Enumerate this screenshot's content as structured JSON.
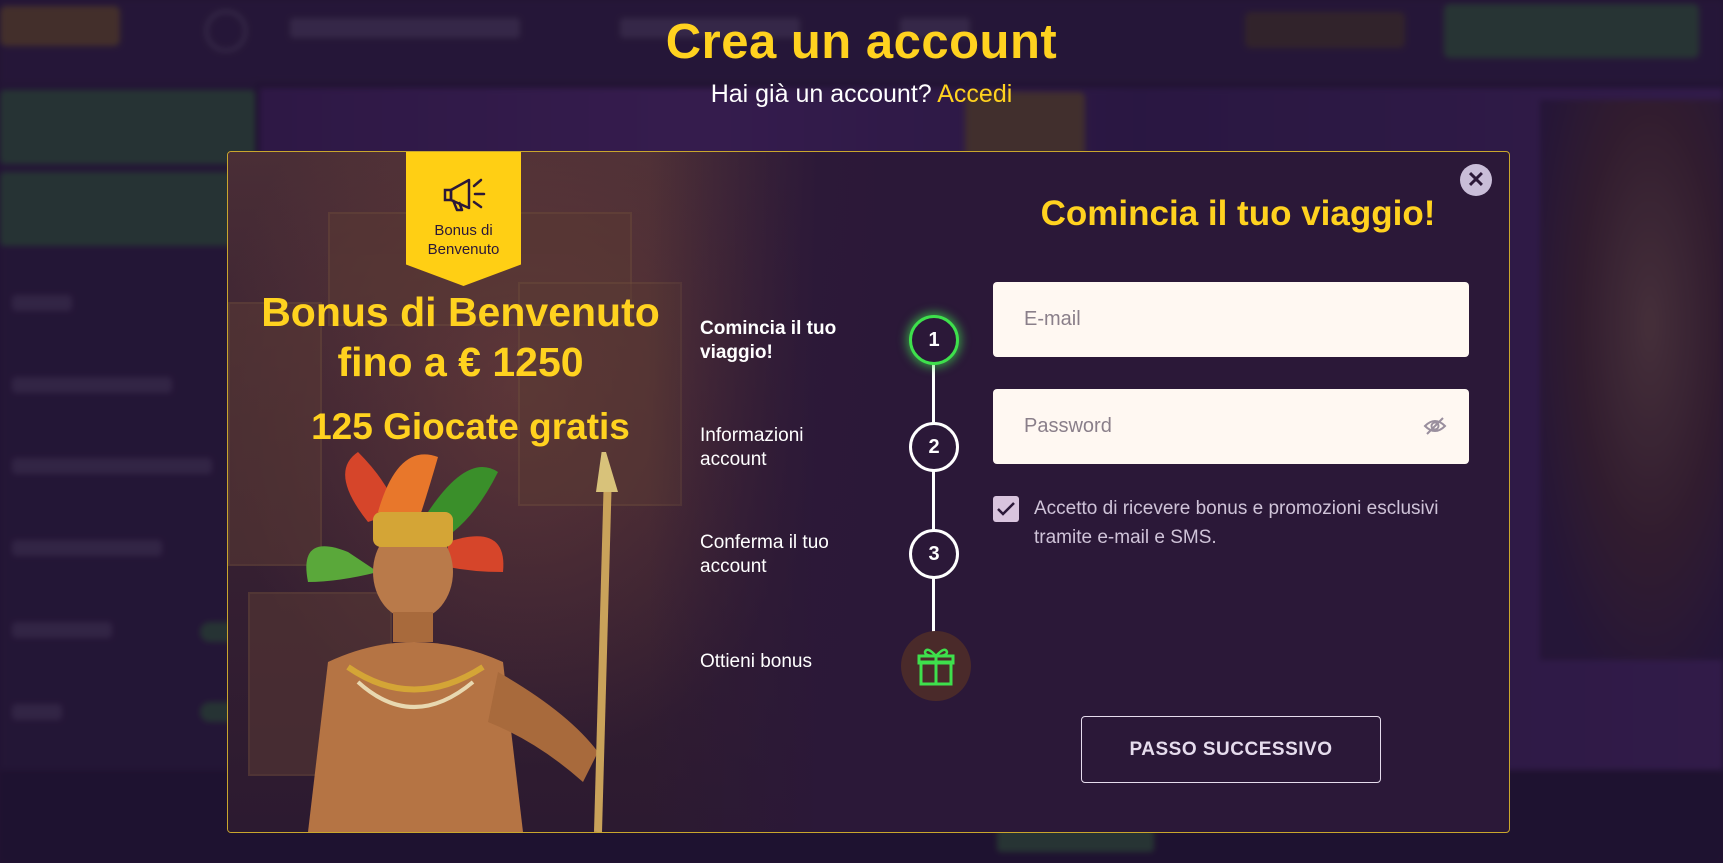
{
  "page": {
    "title": "Crea un account",
    "login_prompt": "Hai già un account?",
    "login_link": "Accedi"
  },
  "promo": {
    "badge_line1": "Bonus di",
    "badge_line2": "Benvenuto",
    "headline_line1": "Bonus di Benvenuto",
    "headline_line2": "fino a € 1250",
    "free_plays": "125 Giocate gratis"
  },
  "steps": [
    {
      "label": "Comincia il tuo viaggio!",
      "number": "1",
      "active": true
    },
    {
      "label": "Informazioni account",
      "number": "2",
      "active": false
    },
    {
      "label": "Conferma il tuo account",
      "number": "3",
      "active": false
    },
    {
      "label": "Ottieni bonus",
      "icon": "gift-icon",
      "active": false
    }
  ],
  "form": {
    "title": "Comincia il tuo viaggio!",
    "email_placeholder": "E-mail",
    "password_placeholder": "Password",
    "consent_text": "Accetto di ricevere bonus e promozioni esclusivi tramite e-mail e SMS.",
    "consent_checked": true,
    "next_button": "PASSO SUCCESSIVO",
    "close_icon": "close-icon"
  },
  "colors": {
    "accent_yellow": "#ffd21f",
    "modal_bg": "#2b1838",
    "active_step": "#3ee04c",
    "brand_green": "#3f9f40"
  }
}
